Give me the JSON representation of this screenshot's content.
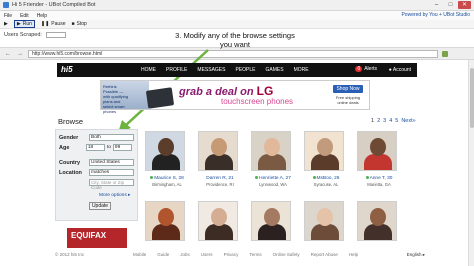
{
  "window": {
    "title": "Hi 5 Friender - UBot Compiled Bot",
    "menu": [
      "File",
      "Edit",
      "Help"
    ],
    "powered_by": "Powered by You + UBot Studio",
    "controls": {
      "minimize": "–",
      "maximize": "□",
      "close": "✕"
    }
  },
  "toolbar": {
    "items": [
      {
        "icon": "play-icon",
        "glyph": "▶",
        "label": ""
      },
      {
        "icon": "run-icon",
        "glyph": "▶",
        "label": "Run"
      },
      {
        "icon": "pause-icon",
        "glyph": "❚❚",
        "label": "Pause"
      },
      {
        "icon": "stop-icon",
        "glyph": "■",
        "label": "Stop"
      }
    ]
  },
  "status": {
    "users_scraped_label": "Users Scraped:",
    "users_scraped_value": ""
  },
  "browser": {
    "url": "http://www.hi5.com/browse.html",
    "back": "←",
    "forward": "→"
  },
  "annotation": {
    "text": "3. Modify any of the browse settings you want"
  },
  "site": {
    "logo": "hi5",
    "nav": [
      "HOME",
      "PROFILE",
      "MESSAGES",
      "PEOPLE",
      "GAMES",
      "MORE"
    ],
    "alerts_count": "0",
    "alerts_label": "Alerts",
    "account_label": "Account"
  },
  "ad": {
    "att_text": "Rethink Possible — with qualifying plans and select smart phones",
    "promo_left": "grab a deal on",
    "brand": "LG",
    "sub": "touchscreen phones",
    "shop_now": "Shop Now",
    "ship": "Free shipping online deals"
  },
  "browse": {
    "title": "Browse",
    "pages": [
      "1",
      "2",
      "3",
      "4",
      "5"
    ],
    "next": "Next»",
    "filters": {
      "gender_label": "Gender",
      "gender_value": "Both",
      "age_label": "Age",
      "age_min": "18",
      "age_to": "to",
      "age_max": "99",
      "country_label": "Country",
      "country_value": "United States",
      "location_label": "Location",
      "location_value": "matches",
      "city_placeholder": "City, State or Zip Code",
      "more_options": "More options ▸",
      "update": "Update"
    },
    "profiles": [
      {
        "name": "Maurice S, 28",
        "location": "Birmingham, AL",
        "online": true
      },
      {
        "name": "Darren R, 21",
        "location": "Providence, RI",
        "online": false
      },
      {
        "name": "Henriette A, 27",
        "location": "Lynnwood, WA",
        "online": true
      },
      {
        "name": "MsBoo, 26",
        "location": "Syracuse, AL",
        "online": true
      },
      {
        "name": "Anne T, 30",
        "location": "Marietta, GA",
        "online": true
      },
      {
        "name": "",
        "location": "",
        "online": false
      },
      {
        "name": "",
        "location": "",
        "online": false
      },
      {
        "name": "",
        "location": "",
        "online": false
      },
      {
        "name": "",
        "location": "",
        "online": false
      },
      {
        "name": "",
        "location": "",
        "online": false
      }
    ]
  },
  "ad2": {
    "brand": "EQUIFAX"
  },
  "footer": {
    "copyright": "© 2012 hi5 Inc",
    "links": [
      "Mobile",
      "Guide",
      "Jobs",
      "Users",
      "Privacy",
      "Terms",
      "Online Safety",
      "Report Abuse",
      "Help"
    ],
    "language": "English ▸"
  },
  "colors": {
    "nav_bg": "#111111",
    "link": "#1a4fa0",
    "annotation_arrow": "#6db33f",
    "alert_badge": "#e12f2f"
  }
}
